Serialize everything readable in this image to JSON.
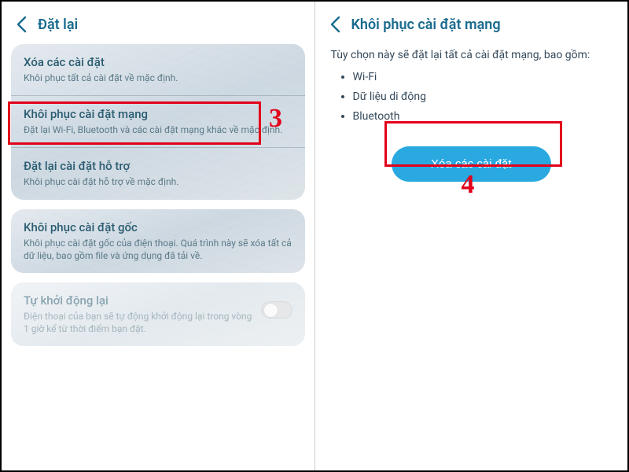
{
  "left": {
    "header": {
      "title": "Đặt lại"
    },
    "group1": {
      "items": [
        {
          "title": "Xóa các cài đặt",
          "desc": "Khôi phục tất cả cài đặt về mặc định."
        },
        {
          "title": "Khôi phục cài đặt mạng",
          "desc": "Đặt lại Wi-Fi, Bluetooth và các cài đặt mạng khác về mặc định."
        },
        {
          "title": "Đặt lại cài đặt hỗ trợ",
          "desc": "Khôi phục cài đặt hỗ trợ về mặc định."
        }
      ]
    },
    "group2": {
      "title": "Khôi phục cài đặt gốc",
      "desc": "Khôi phục cài đặt gốc của điện thoại. Quá trình này sẽ xóa tất cả dữ liệu, bao gồm file và ứng dụng đã tải về."
    },
    "group3": {
      "title": "Tự khởi động lại",
      "desc": "Điện thoại của bạn sẽ tự động khởi động lại trong vòng 1 giờ kể từ thời điểm bạn đặt."
    }
  },
  "right": {
    "header": {
      "title": "Khôi phục cài đặt mạng"
    },
    "desc": "Tùy chọn này sẽ đặt lại tất cả cài đặt mạng, bao gồm:",
    "list": [
      "Wi-Fi",
      "Dữ liệu di động",
      "Bluetooth"
    ],
    "cta": "Xóa các cài đặt"
  },
  "annotations": {
    "step3": "3",
    "step4": "4"
  }
}
